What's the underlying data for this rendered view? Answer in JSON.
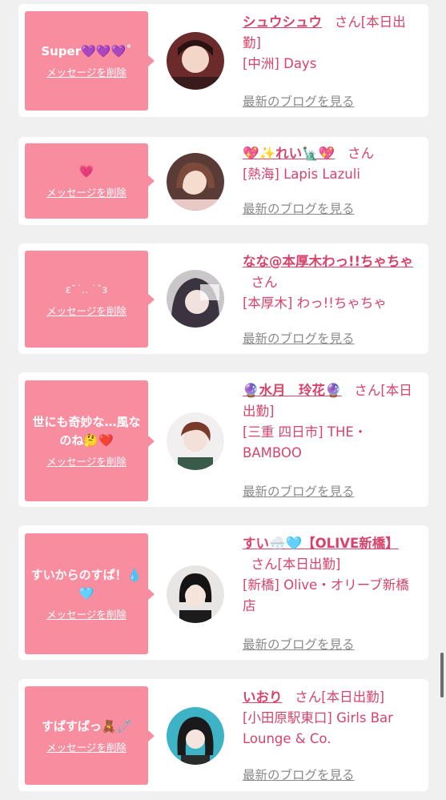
{
  "delete_label": "メッセージを削除",
  "blog_label": "最新のブログを見る",
  "cards": [
    {
      "message": "Super💜💜💜˚",
      "name": "シュウシュウ",
      "san": "さん",
      "status": "[本日出勤]",
      "shop": "[中洲] Days"
    },
    {
      "message": "💗",
      "name": "💖✨れい🗽💖",
      "san": "さん",
      "status": "",
      "shop": "[熱海] Lapis Lazuli"
    },
    {
      "message": "ε˘˙.. ˙˘з",
      "name": "なな@本厚木わっ!!ちゃちゃ",
      "san": "さん",
      "status": "",
      "shop": "[本厚木] わっ!!ちゃちゃ"
    },
    {
      "message": "世にも奇妙な…風なのね🤔❤️",
      "name": "🔮水月　玲花🔮",
      "san": "さん",
      "status": "[本日出勤]",
      "shop": "[三重 四日市] THE・BAMBOO"
    },
    {
      "message": "すいからのすぱ！💧🩵",
      "name": "すい🌨️🩵【OLIVE新橋】",
      "san": "さん",
      "status": "[本日出勤]",
      "shop": "[新橋] Olive・オリーブ新橋店"
    },
    {
      "message": "すぱすぱっ🧸🧷",
      "name": "いおり",
      "san": "さん",
      "status": "[本日出勤]",
      "shop": "[小田原駅東口] Girls Bar Lounge & Co."
    }
  ]
}
